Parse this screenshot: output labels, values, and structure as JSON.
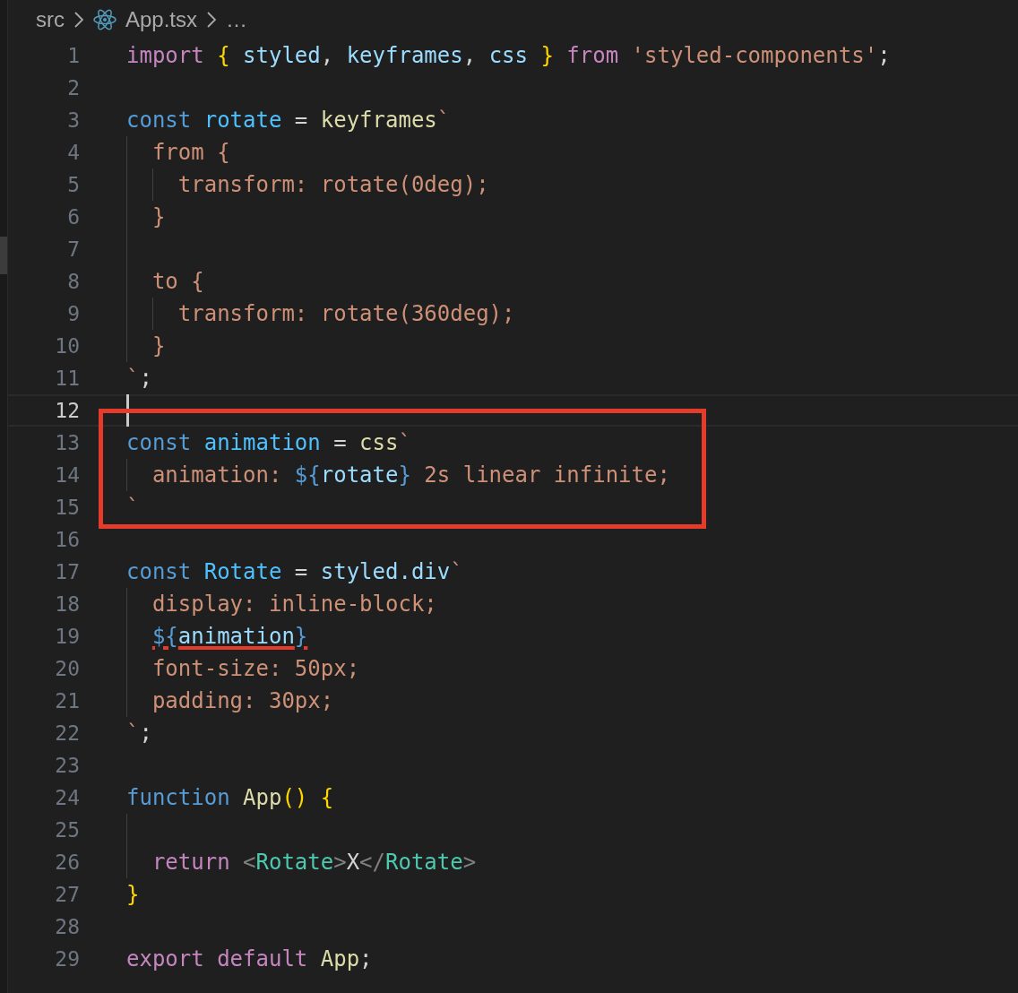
{
  "breadcrumb": [
    {
      "label": "src",
      "kind": "folder"
    },
    {
      "label": "App.tsx",
      "kind": "file"
    },
    {
      "label": "…",
      "kind": "more"
    }
  ],
  "lines": [
    {
      "number": "1",
      "current": false,
      "boxed": false,
      "tokens": [
        {
          "kind": "kw",
          "t": "import "
        },
        {
          "kind": "bracket",
          "t": "{ "
        },
        {
          "kind": "var",
          "t": "styled"
        },
        {
          "kind": "punct",
          "t": ", "
        },
        {
          "kind": "var",
          "t": "keyframes"
        },
        {
          "kind": "punct",
          "t": ", "
        },
        {
          "kind": "var",
          "t": "css "
        },
        {
          "kind": "bracket",
          "t": "} "
        },
        {
          "kind": "kw",
          "t": "from "
        },
        {
          "kind": "str",
          "t": "'styled-components'"
        },
        {
          "kind": "punct",
          "t": ";"
        }
      ]
    },
    {
      "number": "2",
      "current": false,
      "boxed": false
    },
    {
      "number": "3",
      "current": false,
      "boxed": false,
      "tokens": [
        {
          "kind": "storage",
          "t": "const "
        },
        {
          "kind": "const",
          "t": "rotate "
        },
        {
          "kind": "punct",
          "t": "= "
        },
        {
          "kind": "fn",
          "t": "keyframes"
        },
        {
          "kind": "str",
          "t": "`"
        }
      ]
    },
    {
      "number": "4",
      "current": false,
      "boxed": false,
      "tokens": [
        {
          "kind": "str",
          "t": "  from {"
        }
      ]
    },
    {
      "number": "5",
      "current": false,
      "boxed": false,
      "tokens": [
        {
          "kind": "str",
          "t": "    transform: rotate(0deg);"
        }
      ]
    },
    {
      "number": "6",
      "current": false,
      "boxed": false,
      "tokens": [
        {
          "kind": "str",
          "t": "  }"
        }
      ]
    },
    {
      "number": "7",
      "current": false,
      "boxed": false
    },
    {
      "number": "8",
      "current": false,
      "boxed": false,
      "tokens": [
        {
          "kind": "str",
          "t": "  to {"
        }
      ]
    },
    {
      "number": "9",
      "current": false,
      "boxed": false,
      "tokens": [
        {
          "kind": "str",
          "t": "    transform: rotate(360deg);"
        }
      ]
    },
    {
      "number": "10",
      "current": false,
      "boxed": false,
      "tokens": [
        {
          "kind": "str",
          "t": "  }"
        }
      ]
    },
    {
      "number": "11",
      "current": false,
      "boxed": false,
      "tokens": [
        {
          "kind": "str",
          "t": "`"
        },
        {
          "kind": "punct",
          "t": ";"
        }
      ]
    },
    {
      "number": "12",
      "current": true,
      "boxed": false
    },
    {
      "number": "13",
      "current": false,
      "boxed": true,
      "tokens": [
        {
          "kind": "storage",
          "t": "const "
        },
        {
          "kind": "const",
          "t": "animation "
        },
        {
          "kind": "punct",
          "t": "= "
        },
        {
          "kind": "fn",
          "t": "css"
        },
        {
          "kind": "str",
          "t": "`"
        }
      ]
    },
    {
      "number": "14",
      "current": false,
      "boxed": true,
      "tokens": [
        {
          "kind": "str",
          "t": "  animation: "
        },
        {
          "kind": "storage",
          "t": "${"
        },
        {
          "kind": "var",
          "t": "rotate"
        },
        {
          "kind": "storage",
          "t": "}"
        },
        {
          "kind": "str",
          "t": " 2s linear infinite;"
        }
      ]
    },
    {
      "number": "15",
      "current": false,
      "boxed": true,
      "tokens": [
        {
          "kind": "str",
          "t": "`"
        }
      ]
    },
    {
      "number": "16",
      "current": false,
      "boxed": false
    },
    {
      "number": "17",
      "current": false,
      "boxed": false,
      "tokens": [
        {
          "kind": "storage",
          "t": "const "
        },
        {
          "kind": "const",
          "t": "Rotate "
        },
        {
          "kind": "punct",
          "t": "= "
        },
        {
          "kind": "var",
          "t": "styled.div"
        },
        {
          "kind": "str",
          "t": "`"
        }
      ]
    },
    {
      "number": "18",
      "current": false,
      "boxed": false,
      "tokens": [
        {
          "kind": "str",
          "t": "  display: inline-block;"
        }
      ]
    },
    {
      "number": "19",
      "current": false,
      "boxed": false,
      "tokens": [
        {
          "kind": "storage",
          "t": "  ${",
          "underlined": true
        },
        {
          "kind": "var",
          "t": "animation",
          "underlined": true
        },
        {
          "kind": "storage",
          "t": "}",
          "underlined": true
        }
      ]
    },
    {
      "number": "20",
      "current": false,
      "boxed": false,
      "tokens": [
        {
          "kind": "str",
          "t": "  font-size: 50px;"
        }
      ]
    },
    {
      "number": "21",
      "current": false,
      "boxed": false,
      "tokens": [
        {
          "kind": "str",
          "t": "  padding: 30px;"
        }
      ]
    },
    {
      "number": "22",
      "current": false,
      "boxed": false,
      "tokens": [
        {
          "kind": "str",
          "t": "`"
        },
        {
          "kind": "punct",
          "t": ";"
        }
      ]
    },
    {
      "number": "23",
      "current": false,
      "boxed": false
    },
    {
      "number": "24",
      "current": false,
      "boxed": false,
      "tokens": [
        {
          "kind": "storage",
          "t": "function "
        },
        {
          "kind": "fn",
          "t": "App"
        },
        {
          "kind": "bracket",
          "t": "() {"
        }
      ]
    },
    {
      "number": "25",
      "current": false,
      "boxed": false
    },
    {
      "number": "26",
      "current": false,
      "boxed": false,
      "tokens": [
        {
          "kind": "kw",
          "t": "  return "
        },
        {
          "kind": "angle",
          "t": "<"
        },
        {
          "kind": "tag",
          "t": "Rotate"
        },
        {
          "kind": "angle",
          "t": ">"
        },
        {
          "kind": "punct",
          "t": "X"
        },
        {
          "kind": "angle",
          "t": "</"
        },
        {
          "kind": "tag",
          "t": "Rotate"
        },
        {
          "kind": "angle",
          "t": ">"
        }
      ]
    },
    {
      "number": "27",
      "current": false,
      "boxed": false,
      "tokens": [
        {
          "kind": "bracket",
          "t": "}"
        }
      ]
    },
    {
      "number": "28",
      "current": false,
      "boxed": false
    },
    {
      "number": "29",
      "current": false,
      "boxed": false,
      "tokens": [
        {
          "kind": "kw",
          "t": "export default "
        },
        {
          "kind": "fn",
          "t": "App"
        },
        {
          "kind": "punct",
          "t": ";"
        }
      ]
    }
  ]
}
